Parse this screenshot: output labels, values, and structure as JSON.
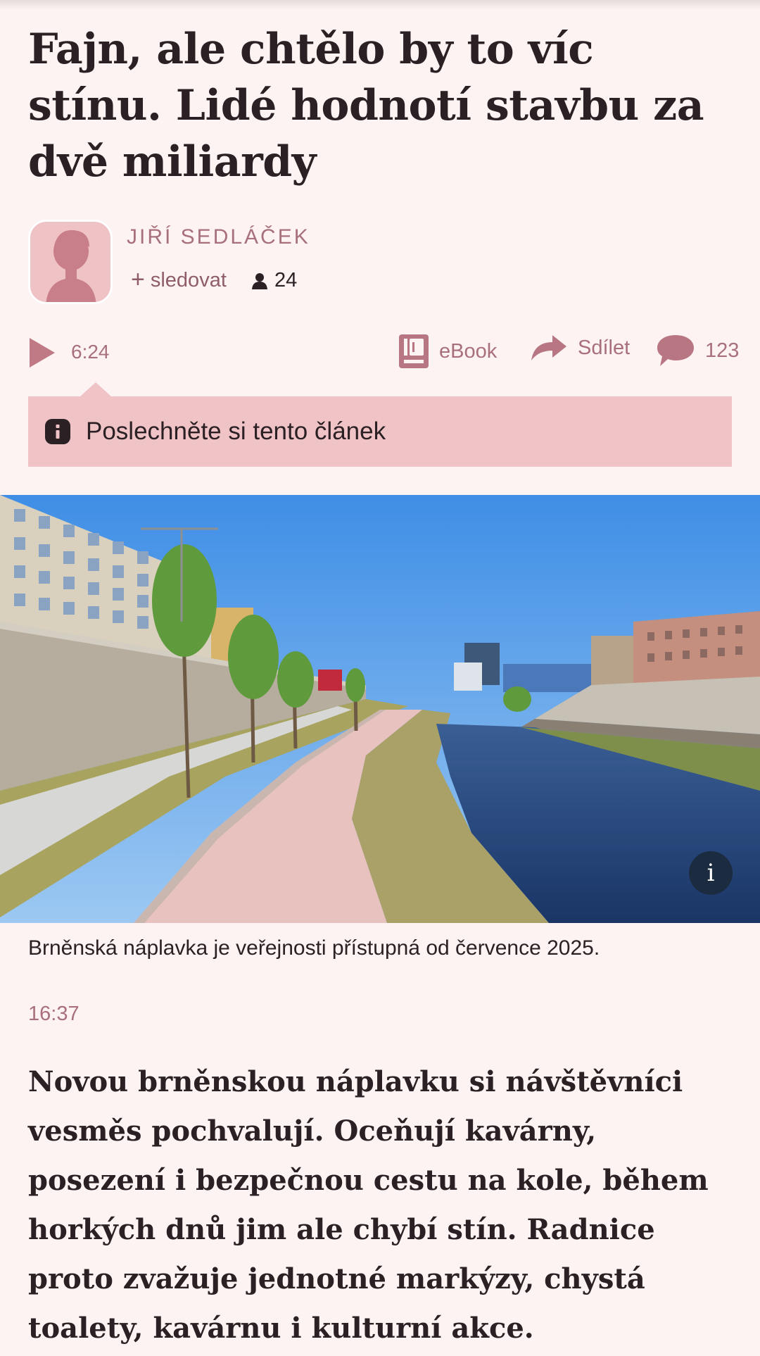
{
  "article": {
    "title": "Fajn, ale chtělo by to víc stínu. Lidé hodnotí stavbu za dvě miliardy",
    "author": {
      "name": "JIŘÍ SEDLÁČEK",
      "follow_label": "sledovat",
      "followers": "24"
    },
    "toolbar": {
      "duration": "6:24",
      "ebook_label": "eBook",
      "share_label": "Sdílet",
      "comments_count": "123"
    },
    "tooltip_text": "Poslechněte si tento článek",
    "photo": {
      "caption": "Brněnská náplavka je veřejnosti přístupná od července 2025.",
      "info_label": "i"
    },
    "timestamp": "16:37",
    "perex": "Novou brněnskou náplavku si návštěvníci vesměs pochvalují. Oceňují kavárny, posezení i bezpečnou cestu na kole, během horkých dnů jim ale chybí stín. Radnice proto zvažuje jednotné markýzy, chystá toalety, kavárnu i kulturní akce."
  },
  "icons": {
    "play": "play-icon",
    "follow": "plus-icon",
    "followers": "person-icon",
    "ebook": "book-icon",
    "share": "share-arrow-icon",
    "comments": "speech-bubble-icon",
    "tooltip": "info-icon",
    "photo_info": "info-icon"
  },
  "colors": {
    "background": "#fdf3f3",
    "accent": "#a8707b",
    "tooltip_bg": "#f0c4c6",
    "text": "#2b2024"
  }
}
